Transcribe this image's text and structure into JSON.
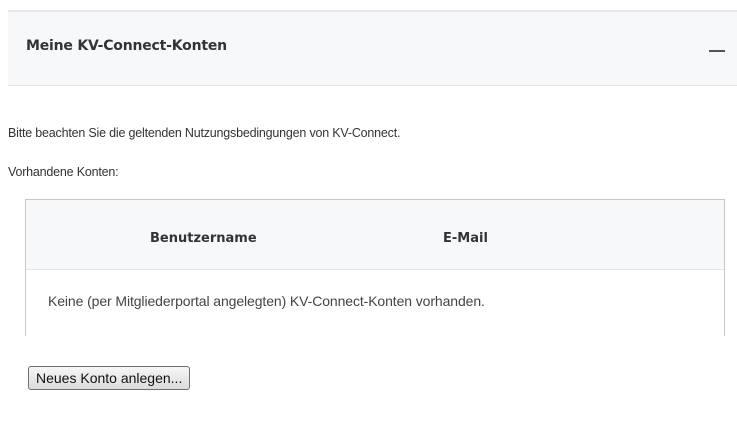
{
  "panel": {
    "title": "Meine KV-Connect-Konten",
    "collapse_icon": "minus-icon"
  },
  "content": {
    "notice": "Bitte beachten Sie die geltenden Nutzungsbedingungen von KV-Connect.",
    "accounts_label": "Vorhandene Konten:"
  },
  "table": {
    "columns": [
      "Benutzername",
      "E-Mail"
    ],
    "empty_message": "Keine (per Mitgliederportal angelegten) KV-Connect-Konten vorhanden."
  },
  "actions": {
    "new_account_label": "Neues Konto anlegen..."
  }
}
